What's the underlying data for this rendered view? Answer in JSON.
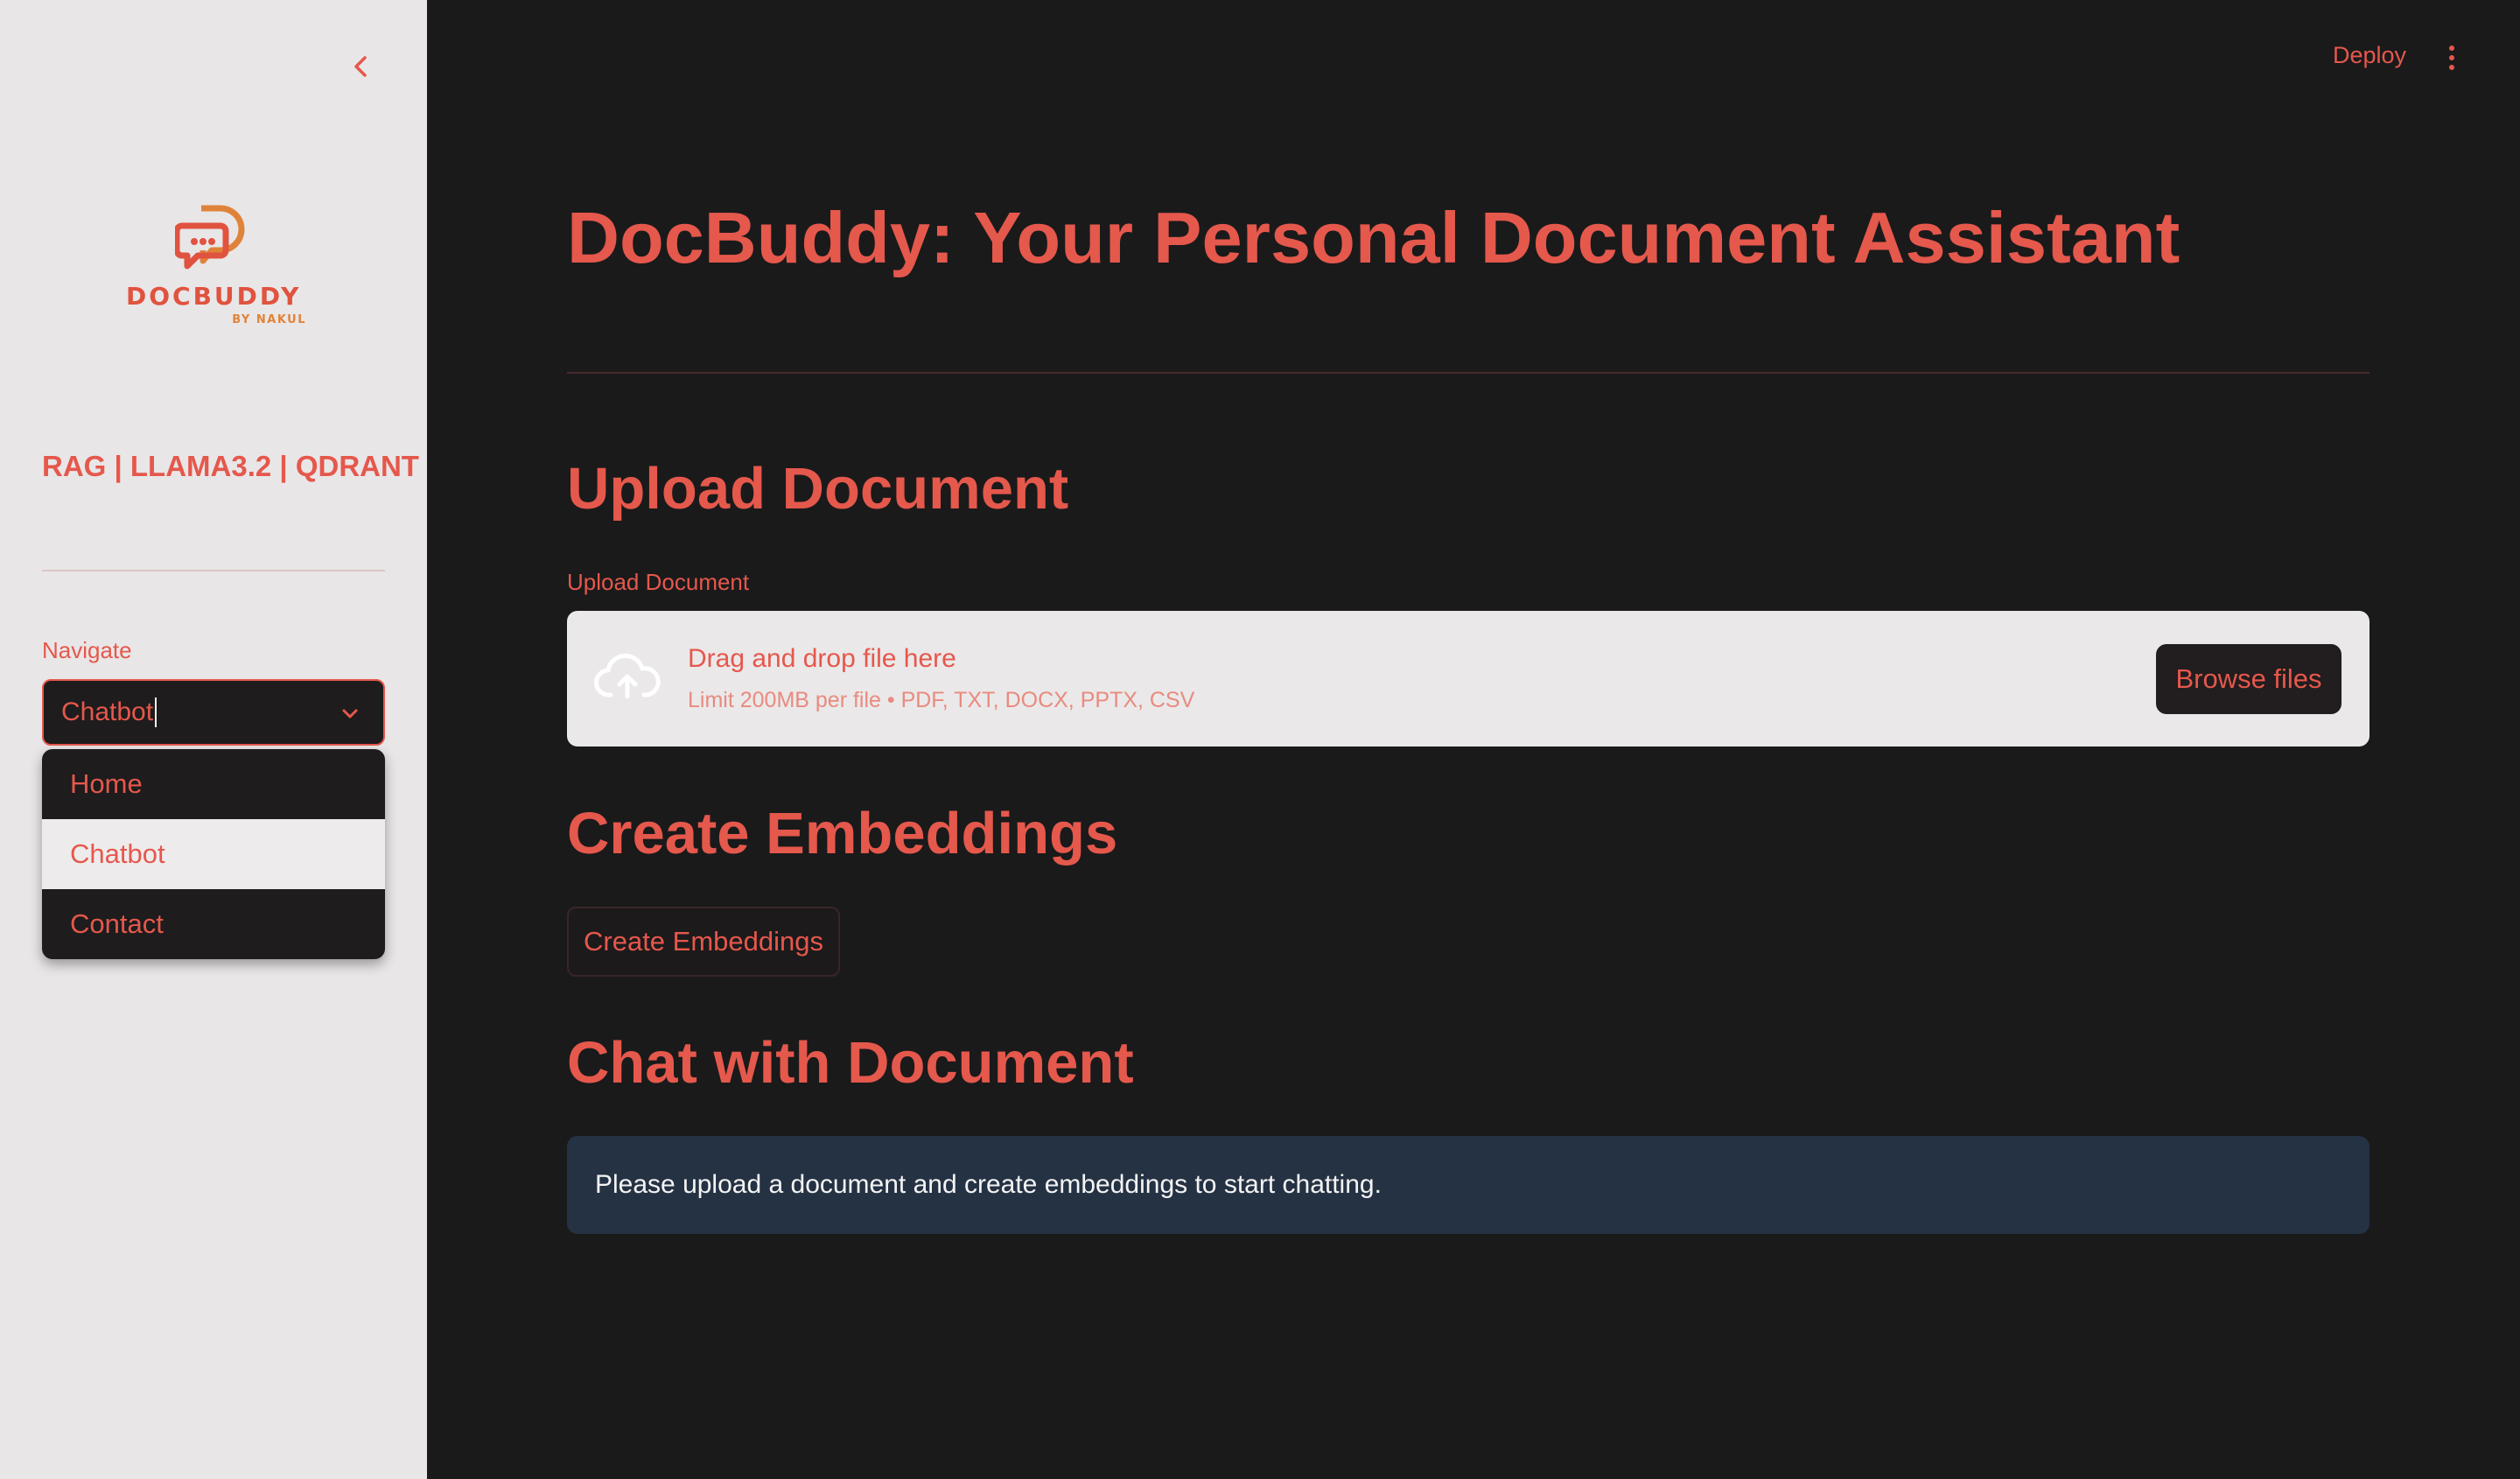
{
  "sidebar": {
    "logo": {
      "wordmark": "DOCBUDDY",
      "sub": "BY NAKUL"
    },
    "tagline": "RAG | LLAMA3.2 | QDRANT",
    "nav_label": "Navigate",
    "nav_selected": "Chatbot",
    "nav_options": [
      {
        "label": "Home",
        "selected": false
      },
      {
        "label": "Chatbot",
        "selected": true
      },
      {
        "label": "Contact",
        "selected": false
      }
    ]
  },
  "header": {
    "deploy_label": "Deploy",
    "menu_icon": "kebab-menu-icon"
  },
  "main": {
    "title": "DocBuddy: Your Personal Document Assistant",
    "upload": {
      "heading": "Upload Document",
      "label": "Upload Document",
      "dropzone_title": "Drag and drop file here",
      "dropzone_hint": "Limit 200MB per file • PDF, TXT, DOCX, PPTX, CSV",
      "browse_label": "Browse files",
      "icon": "cloud-upload-icon"
    },
    "embeddings": {
      "heading": "Create Embeddings",
      "button_label": "Create Embeddings"
    },
    "chat": {
      "heading": "Chat with Document",
      "info": "Please upload a document and create embeddings to start chatting."
    }
  },
  "colors": {
    "accent": "#e5584c",
    "sidebar_bg": "#e9e6e7",
    "main_bg": "#1a1a1b",
    "info_bg": "#253244"
  }
}
